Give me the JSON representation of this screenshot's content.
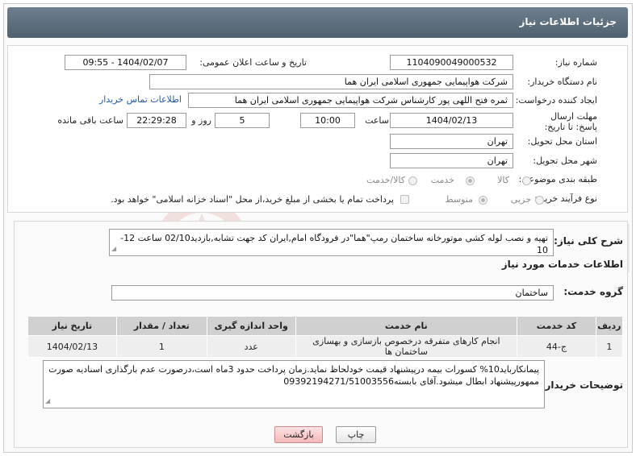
{
  "page_title": "جزئیات اطلاعات نیاز",
  "fields": {
    "need_number_label": "شماره نیاز:",
    "need_number": "1104090049000532",
    "announce_datetime_label": "تاریخ و ساعت اعلان عمومی:",
    "announce_datetime": "1404/02/07 - 09:55",
    "buyer_org_label": "نام دستگاه خریدار:",
    "buyer_org": "شرکت هواپیمایی جمهوری اسلامی ایران هما",
    "requester_label": "ایجاد کننده درخواست:",
    "requester": "ثمره فتح اللهی پور کارشناس شرکت هواپیمایی جمهوری اسلامی ایران هما",
    "buyer_contact_link": "اطلاعات تماس خریدار",
    "deadline_label": "مهلت ارسال پاسخ: تا تاریخ:",
    "deadline_date": "1404/02/13",
    "time_label": "ساعت",
    "deadline_time": "10:00",
    "days_value": "5",
    "days_label": "روز و",
    "remaining_time": "22:29:28",
    "remaining_label": "ساعت باقی مانده",
    "province_label": "استان محل تحویل:",
    "province": "تهران",
    "city_label": "شهر محل تحویل:",
    "city": "تهران",
    "category_label": "طبقه بندی موضوعی:",
    "category_options": [
      "کالا",
      "خدمت",
      "کالا/خدمت"
    ],
    "category_selected": "خدمت",
    "process_label": "نوع فرآیند خرید :",
    "process_options": [
      "جزیی",
      "متوسط"
    ],
    "process_selected": "متوسط",
    "treasury_note": "پرداخت تمام یا بخشی از مبلغ خرید،از محل \"اسناد خزانه اسلامی\" خواهد بود."
  },
  "description": {
    "label": "شرح کلی نیاز:",
    "text": "تهیه و نصب لوله کشی موتورخانه ساختمان رمپ\"هما\"در فرودگاه امام,ایران کد جهت تشابه,بازدید02/10 ساعت 12-10"
  },
  "services": {
    "section_title": "اطلاعات خدمات مورد نیاز",
    "group_label": "گروه خدمت:",
    "group_value": "ساختمان",
    "columns": [
      "ردیف",
      "کد خدمت",
      "نام خدمت",
      "واحد اندازه گیری",
      "تعداد / مقدار",
      "تاریخ نیاز"
    ],
    "rows": [
      [
        "1",
        "ج-44",
        "انجام کارهای متفرقه درخصوص بازسازی و بهسازی ساختمان ها",
        "عدد",
        "1",
        "1404/02/13"
      ]
    ]
  },
  "buyer_notes": {
    "label": "توضیحات خریدار:",
    "text": "پیمانکارباید10% کسورات بیمه درپیشنهاد قیمت خودلحاظ نماید.زمان پرداخت حدود 3ماه است،درصورت عدم بارگذاری اسنادیه صورت ممهورپیشنهاد ابطال میشود.آقای بابسته09392194271/51003556"
  },
  "buttons": {
    "print": "چاپ",
    "back": "بازگشت"
  },
  "colors": {
    "title_bar": "#5e6f80",
    "link": "#1f5aa6",
    "back_button": "#f4b9b9",
    "table_header": "#d0d0d0"
  }
}
